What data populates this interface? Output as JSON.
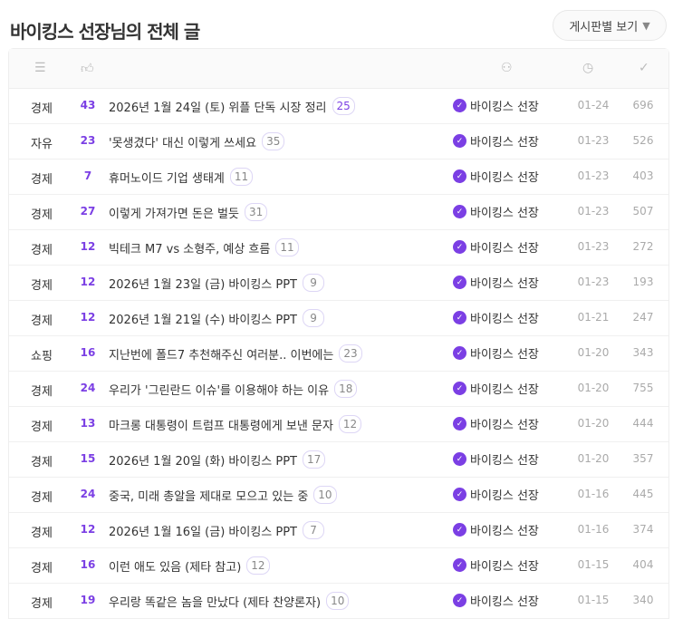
{
  "page_title": "바이킹스 선장님의 전체 글",
  "view_button": "게시판별 보기",
  "header_icons": {
    "filter": "filter-icon",
    "likes": "thumbs-up-icon",
    "author": "user-icon",
    "date": "clock-icon",
    "views": "check-icon"
  },
  "accent": "#7b3fe4",
  "posts": [
    {
      "cat": "경제",
      "likes": "43",
      "title": "2026년 1월 24일 (토) 위플 단독 시장 정리",
      "comments": "25",
      "author": "바이킹스 선장",
      "date": "01-24",
      "views": "696"
    },
    {
      "cat": "자유",
      "likes": "23",
      "title": "'못생겼다' 대신 이렇게 쓰세요",
      "comments": "35",
      "author": "바이킹스 선장",
      "date": "01-23",
      "views": "526"
    },
    {
      "cat": "경제",
      "likes": "7",
      "title": "휴머노이드 기업 생태계",
      "comments": "11",
      "author": "바이킹스 선장",
      "date": "01-23",
      "views": "403"
    },
    {
      "cat": "경제",
      "likes": "27",
      "title": "이렇게 가져가면 돈은 벌듯",
      "comments": "31",
      "author": "바이킹스 선장",
      "date": "01-23",
      "views": "507"
    },
    {
      "cat": "경제",
      "likes": "12",
      "title": "빅테크 M7 vs 소형주, 예상 흐름",
      "comments": "11",
      "author": "바이킹스 선장",
      "date": "01-23",
      "views": "272"
    },
    {
      "cat": "경제",
      "likes": "12",
      "title": "2026년 1월 23일 (금) 바이킹스 PPT",
      "comments": "9",
      "author": "바이킹스 선장",
      "date": "01-23",
      "views": "193"
    },
    {
      "cat": "경제",
      "likes": "12",
      "title": "2026년 1월 21일 (수) 바이킹스 PPT",
      "comments": "9",
      "author": "바이킹스 선장",
      "date": "01-21",
      "views": "247"
    },
    {
      "cat": "쇼핑",
      "likes": "16",
      "title": "지난번에 폴드7 추천해주신 여러분.. 이번에는",
      "comments": "23",
      "author": "바이킹스 선장",
      "date": "01-20",
      "views": "343"
    },
    {
      "cat": "경제",
      "likes": "24",
      "title": "우리가 '그린란드 이슈'를 이용해야 하는 이유",
      "comments": "18",
      "author": "바이킹스 선장",
      "date": "01-20",
      "views": "755"
    },
    {
      "cat": "경제",
      "likes": "13",
      "title": "마크롱 대통령이 트럼프 대통령에게 보낸 문자",
      "comments": "12",
      "author": "바이킹스 선장",
      "date": "01-20",
      "views": "444"
    },
    {
      "cat": "경제",
      "likes": "15",
      "title": "2026년 1월 20일 (화) 바이킹스 PPT",
      "comments": "17",
      "author": "바이킹스 선장",
      "date": "01-20",
      "views": "357"
    },
    {
      "cat": "경제",
      "likes": "24",
      "title": "중국, 미래 총알을 제대로 모으고 있는 중",
      "comments": "10",
      "author": "바이킹스 선장",
      "date": "01-16",
      "views": "445"
    },
    {
      "cat": "경제",
      "likes": "12",
      "title": "2026년 1월 16일 (금) 바이킹스 PPT",
      "comments": "7",
      "author": "바이킹스 선장",
      "date": "01-16",
      "views": "374"
    },
    {
      "cat": "경제",
      "likes": "16",
      "title": "이런 애도 있음 (제타 참고)",
      "comments": "12",
      "author": "바이킹스 선장",
      "date": "01-15",
      "views": "404"
    },
    {
      "cat": "경제",
      "likes": "19",
      "title": "우리랑 똑같은 놈을 만났다 (제타 찬양론자)",
      "comments": "10",
      "author": "바이킹스 선장",
      "date": "01-15",
      "views": "340"
    }
  ]
}
